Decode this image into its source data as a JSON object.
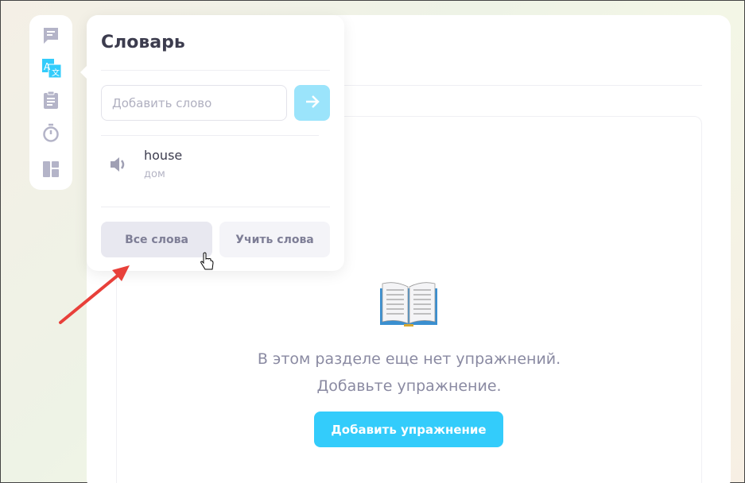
{
  "dictionary": {
    "title": "Словарь",
    "input_placeholder": "Добавить слово",
    "words": [
      {
        "word": "house",
        "translation": "дом"
      }
    ],
    "all_words_label": "Все слова",
    "learn_words_label": "Учить слова"
  },
  "empty_state": {
    "line1": "В этом разделе еще нет упражнений.",
    "line2": "Добавьте упражнение.",
    "add_button": "Добавить упражнение",
    "icon": "open-book-icon"
  },
  "sidebar": {
    "items": [
      "chat-icon",
      "translate-icon",
      "clipboard-icon",
      "timer-icon",
      "layout-icon"
    ],
    "active": "translate-icon"
  },
  "colors": {
    "accent": "#33ccfb",
    "icon_gray": "#b4b4c8"
  }
}
